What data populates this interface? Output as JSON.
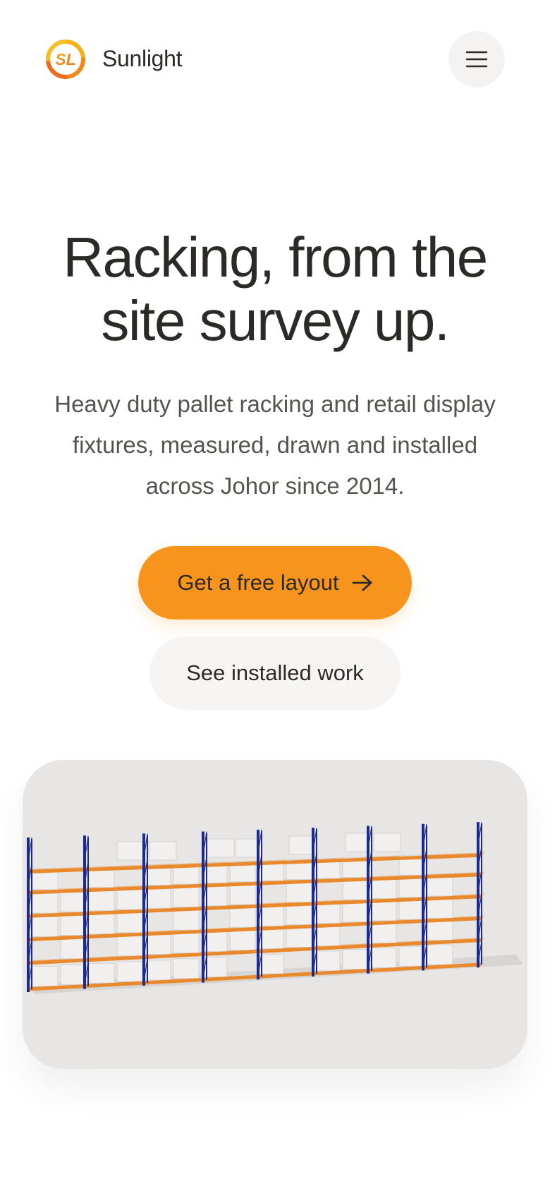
{
  "header": {
    "logo_alt": "SL",
    "brand": "Sunlight",
    "menu_icon": "hamburger-menu-icon"
  },
  "hero": {
    "title_lines": [
      "Racking, from the",
      "site survey up."
    ],
    "subtitle_lines": [
      "Heavy duty pallet racking and retail display",
      "fixtures, measured, drawn and installed",
      "across Johor since 2014."
    ]
  },
  "cta": {
    "primary_label": "Get a free layout",
    "primary_icon": "arrow-right-icon",
    "secondary_label": "See installed work"
  },
  "colors": {
    "accent": "#f7941e",
    "text": "#2b2a27",
    "muted": "#55534f",
    "rack_upright": "#1c2a8c",
    "rack_beam": "#e9892b"
  }
}
